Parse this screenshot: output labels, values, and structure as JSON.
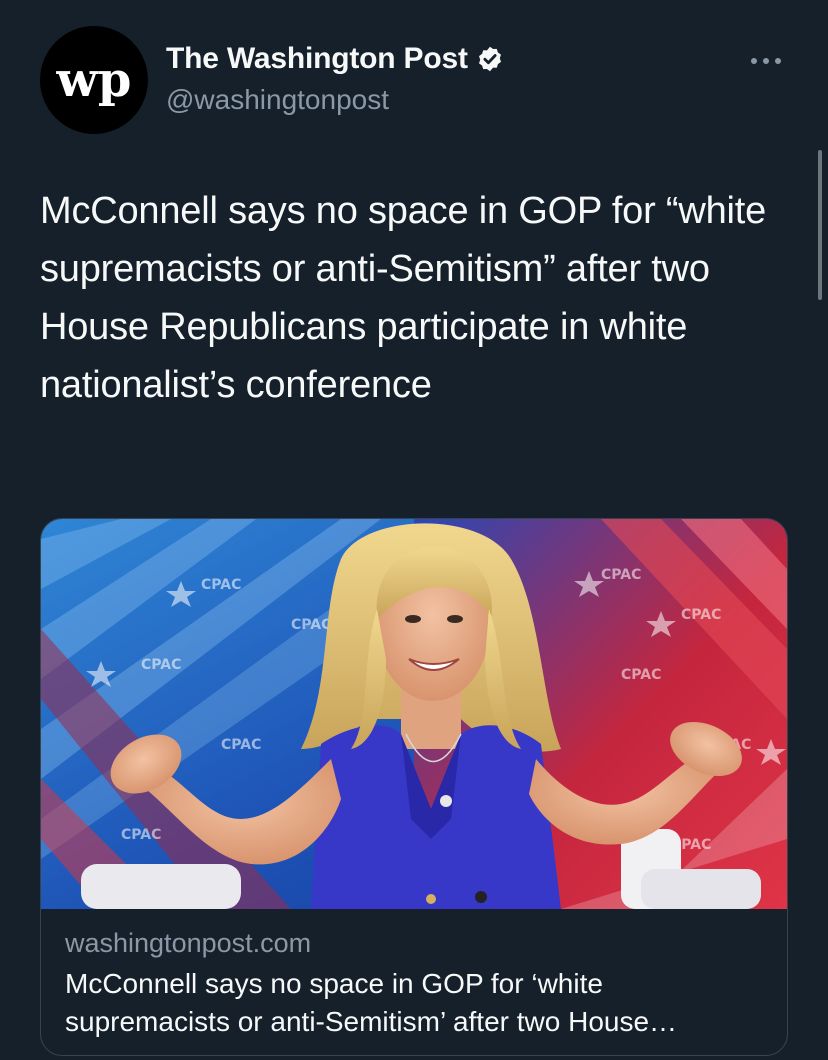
{
  "account": {
    "display_name": "The Washington Post",
    "handle": "@washingtonpost",
    "avatar_monogram": "wp",
    "verified": true
  },
  "tweet": {
    "text": "McConnell says no space in GOP for “white supremacists or anti-Semitism” after two House Republicans participate in white nationalist’s conference"
  },
  "link_card": {
    "domain": "washingtonpost.com",
    "title": "McConnell says no space in GOP for ‘white supremacists or anti-Semitism’ after two House Republicans participate in white nationalist’s conference",
    "backdrop_logo_text": "CPAC"
  },
  "icons": {
    "verified": "verified-badge-icon",
    "more": "more-options-icon"
  },
  "colors": {
    "background": "#15202b",
    "text_primary": "#f7f9f9",
    "text_secondary": "#8b98a5",
    "border": "#38444d",
    "verified_badge": "#f7f9f9"
  }
}
